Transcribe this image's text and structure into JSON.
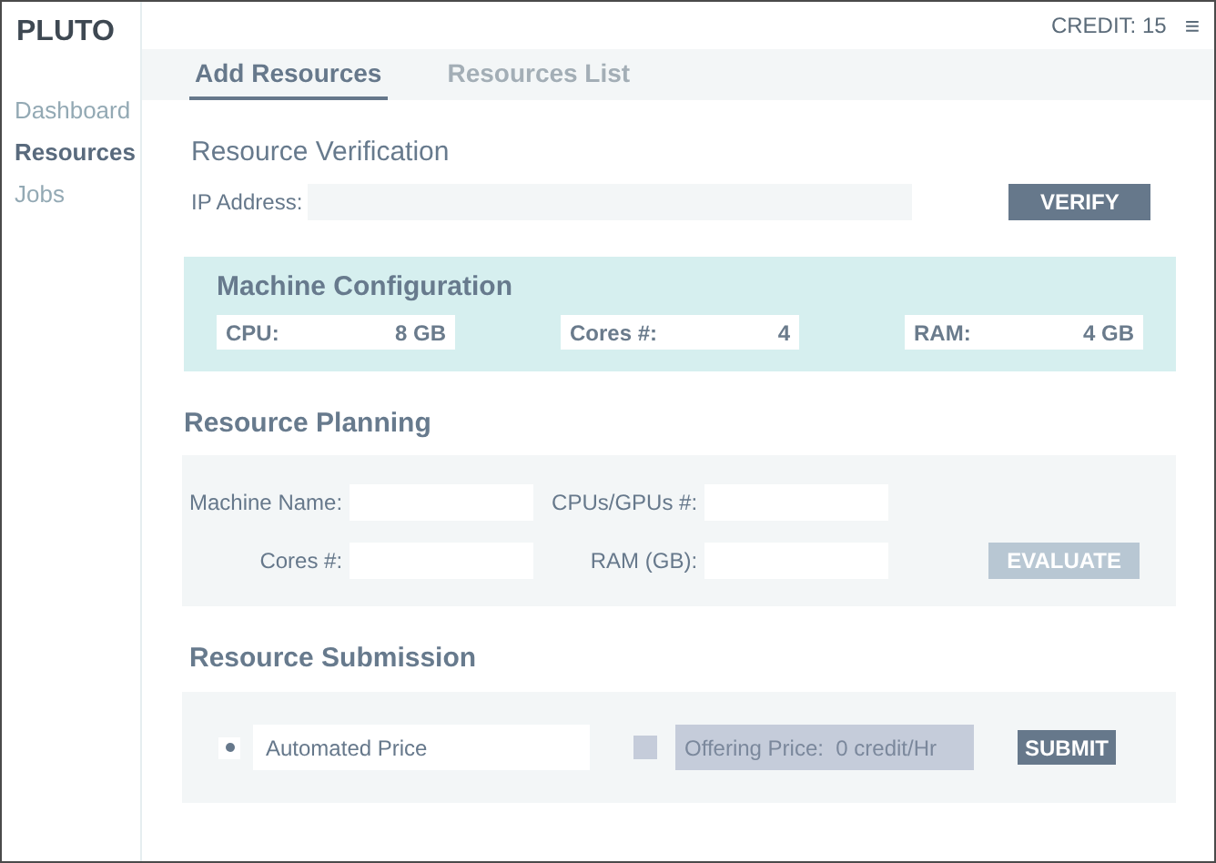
{
  "app": {
    "title": "PLUTO",
    "credit": "CREDIT: 15",
    "menu_icon": "≡"
  },
  "sidebar": {
    "items": [
      {
        "label": "Dashboard",
        "selected": false
      },
      {
        "label": "Resources",
        "selected": true
      },
      {
        "label": "Jobs",
        "selected": false
      }
    ]
  },
  "tabs": [
    {
      "label": "Add Resources",
      "selected": true
    },
    {
      "label": "Resources List",
      "selected": false
    }
  ],
  "verification": {
    "title": "Resource Verification",
    "label": "IP Address:",
    "button": {
      "label": "VERIFY",
      "disabled": false
    }
  },
  "machine_configuration": {
    "title": "Machine Configuration",
    "specs": [
      {
        "label": "CPU:",
        "value": "8 GB"
      },
      {
        "label": "Cores #:",
        "value": "4"
      },
      {
        "label": "RAM:",
        "value": "4 GB"
      }
    ]
  },
  "planning": {
    "title": "Resource Planning",
    "fields": [
      {
        "label": "Machine Name:"
      },
      {
        "label": "CPUs/GPUs #:"
      },
      {
        "label": "Cores #:"
      },
      {
        "label": "RAM (GB):"
      }
    ],
    "button": {
      "label": "EVALUATE",
      "disabled": true
    }
  },
  "submission": {
    "title": "Resource Submission",
    "automated": {
      "label": "Automated Price",
      "selected": true
    },
    "offering": {
      "value": "Offering Price:  0 credit/Hr",
      "checked": false,
      "disabled": true
    },
    "button": {
      "label": "SUBMIT",
      "disabled": false
    }
  }
}
